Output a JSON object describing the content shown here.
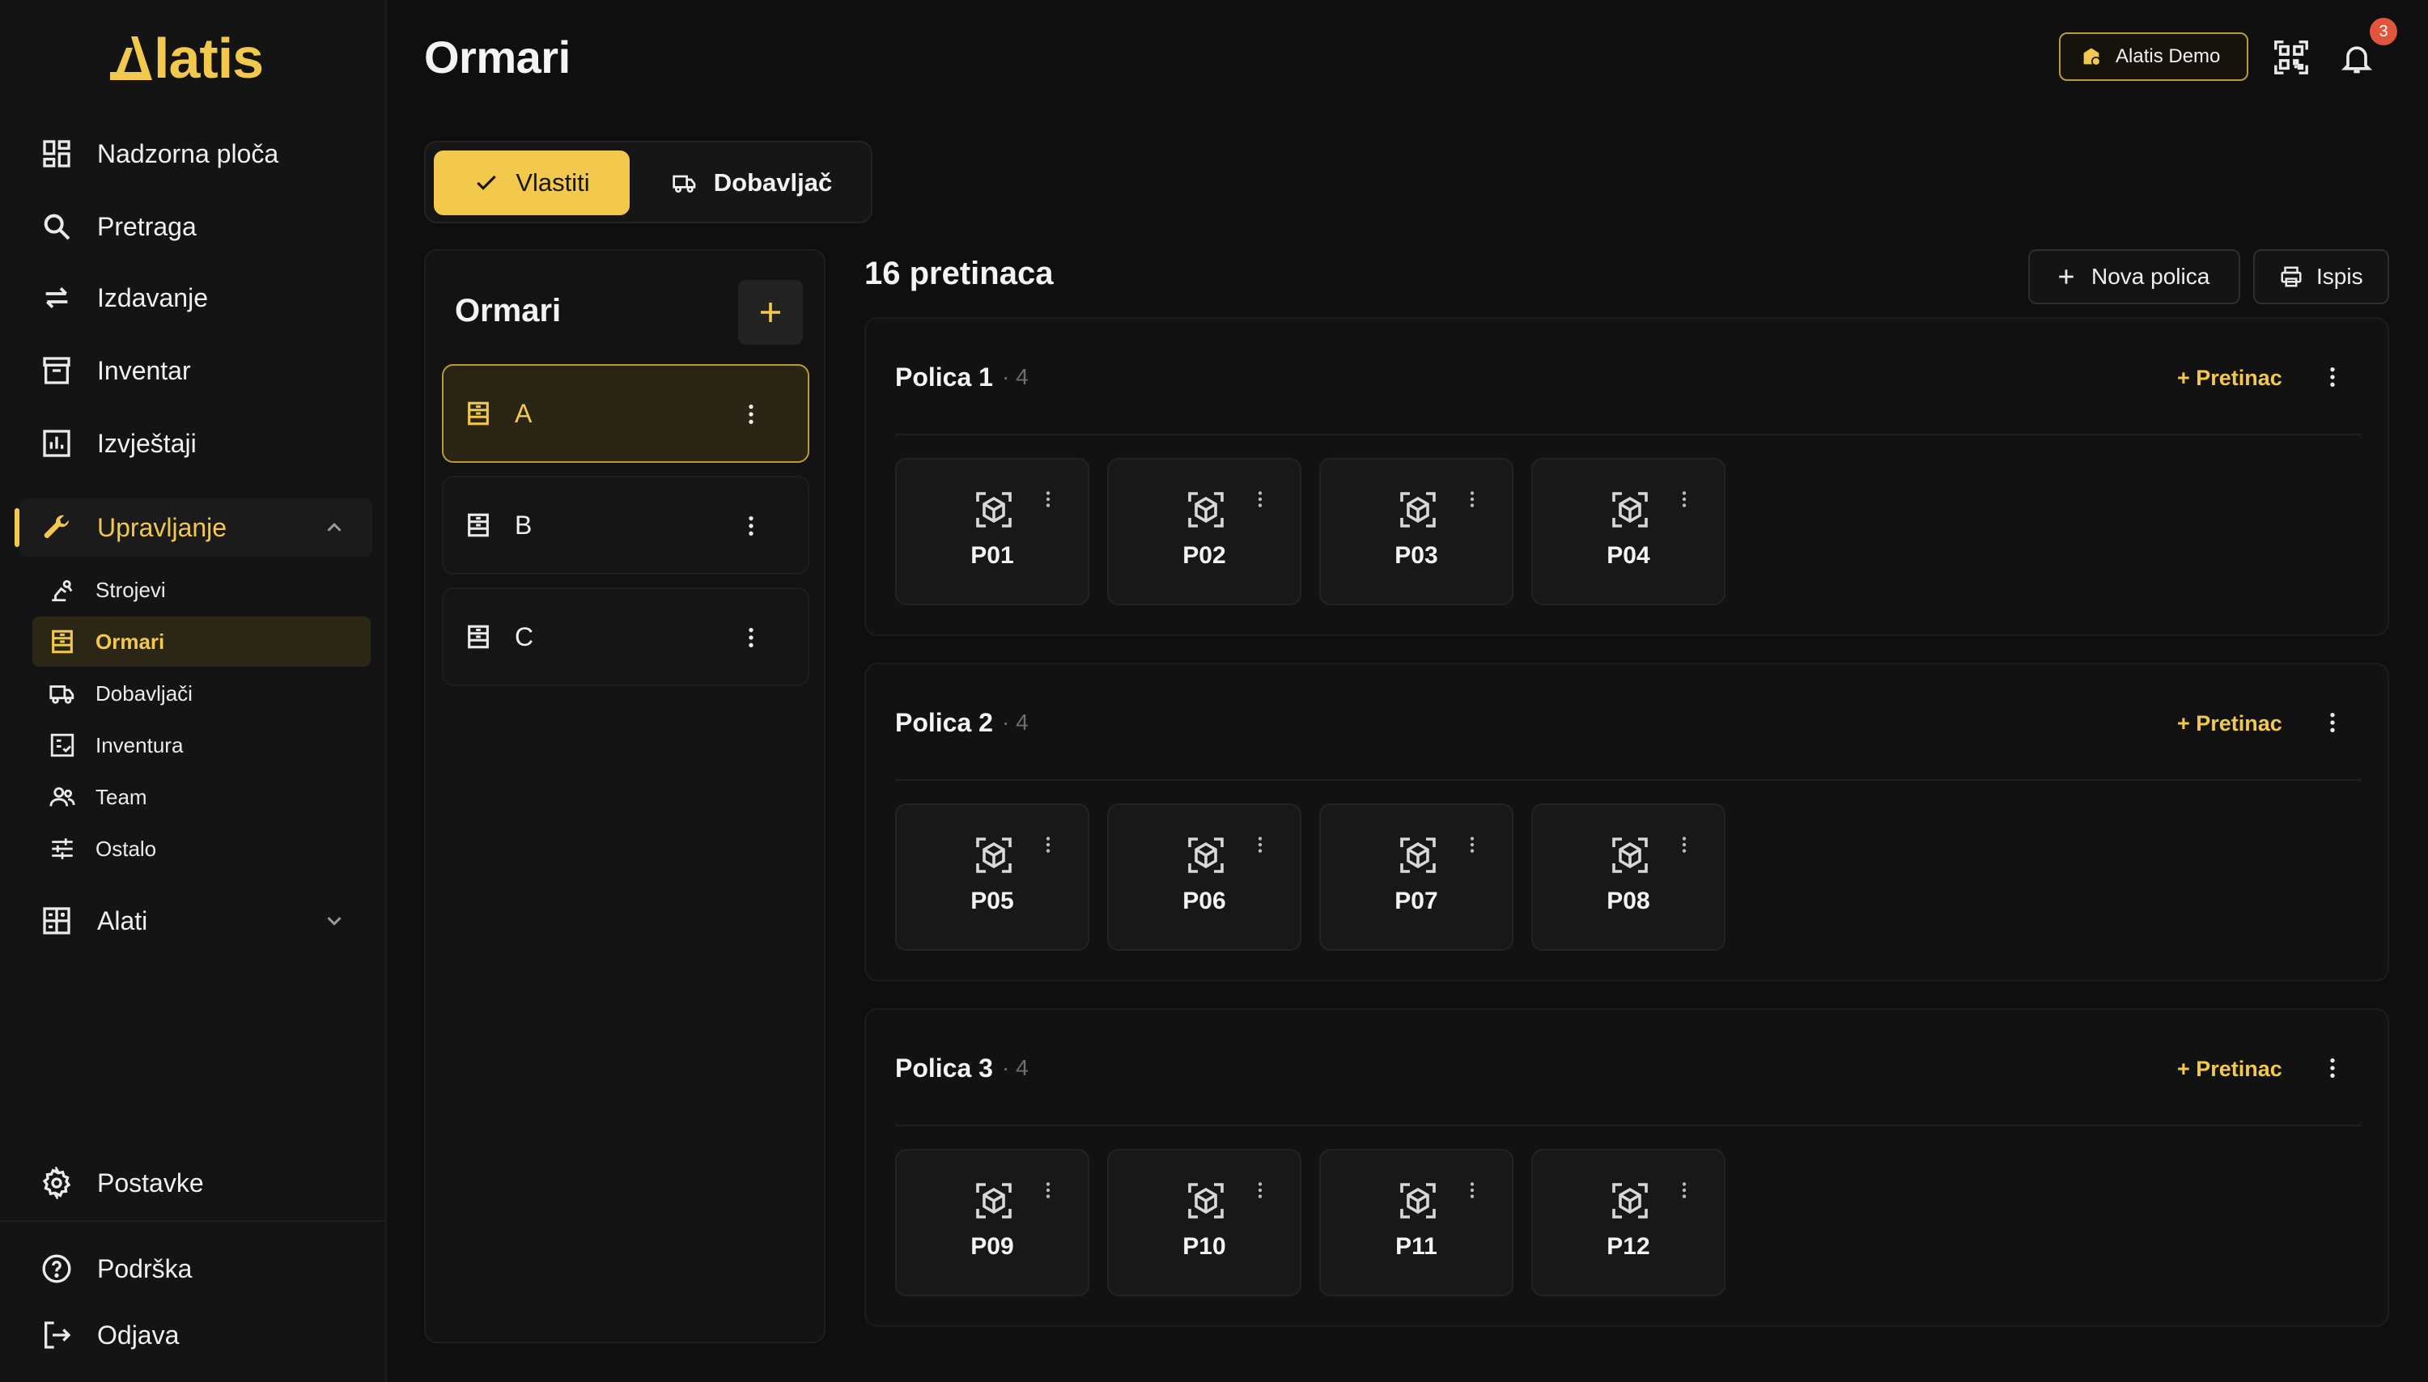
{
  "app": {
    "logo_text": "latis"
  },
  "sidebar": {
    "items": [
      {
        "label": "Nadzorna ploča",
        "icon": "dashboard-icon"
      },
      {
        "label": "Pretraga",
        "icon": "search-icon"
      },
      {
        "label": "Izdavanje",
        "icon": "swap-icon"
      },
      {
        "label": "Inventar",
        "icon": "archive-icon"
      },
      {
        "label": "Izvještaji",
        "icon": "report-icon"
      }
    ],
    "group": {
      "label": "Upravljanje",
      "expanded": true
    },
    "sub_items": [
      {
        "label": "Strojevi",
        "icon": "machine-icon"
      },
      {
        "label": "Ormari",
        "icon": "cabinet-icon",
        "active": true
      },
      {
        "label": "Dobavljači",
        "icon": "truck-icon"
      },
      {
        "label": "Inventura",
        "icon": "checklist-icon"
      },
      {
        "label": "Team",
        "icon": "people-icon"
      },
      {
        "label": "Ostalo",
        "icon": "sliders-icon"
      }
    ],
    "tools": {
      "label": "Alati",
      "expanded": false
    },
    "settings": "Postavke",
    "support": "Podrška",
    "logout": "Odjava"
  },
  "header": {
    "title": "Ormari",
    "account": "Alatis Demo",
    "notifications_count": "3"
  },
  "switch": {
    "own": "Vlastiti",
    "supplier": "Dobavljač",
    "selected": "own"
  },
  "cabinets": {
    "title": "Ormari",
    "items": [
      {
        "label": "A",
        "active": true
      },
      {
        "label": "B"
      },
      {
        "label": "C"
      }
    ]
  },
  "main": {
    "count_title": "16 pretinaca",
    "new_shelf": "Nova polica",
    "print": "Ispis",
    "add_bin": "+ Pretinac",
    "shelves": [
      {
        "title": "Polica 1",
        "count": "· 4",
        "bins": [
          "P01",
          "P02",
          "P03",
          "P04"
        ]
      },
      {
        "title": "Polica 2",
        "count": "· 4",
        "bins": [
          "P05",
          "P06",
          "P07",
          "P08"
        ]
      },
      {
        "title": "Polica 3",
        "count": "· 4",
        "bins": [
          "P09",
          "P10",
          "P11",
          "P12"
        ]
      }
    ]
  },
  "colors": {
    "accent": "#f2c94c",
    "background": "#0f0f0f",
    "badge": "#e2553d"
  }
}
